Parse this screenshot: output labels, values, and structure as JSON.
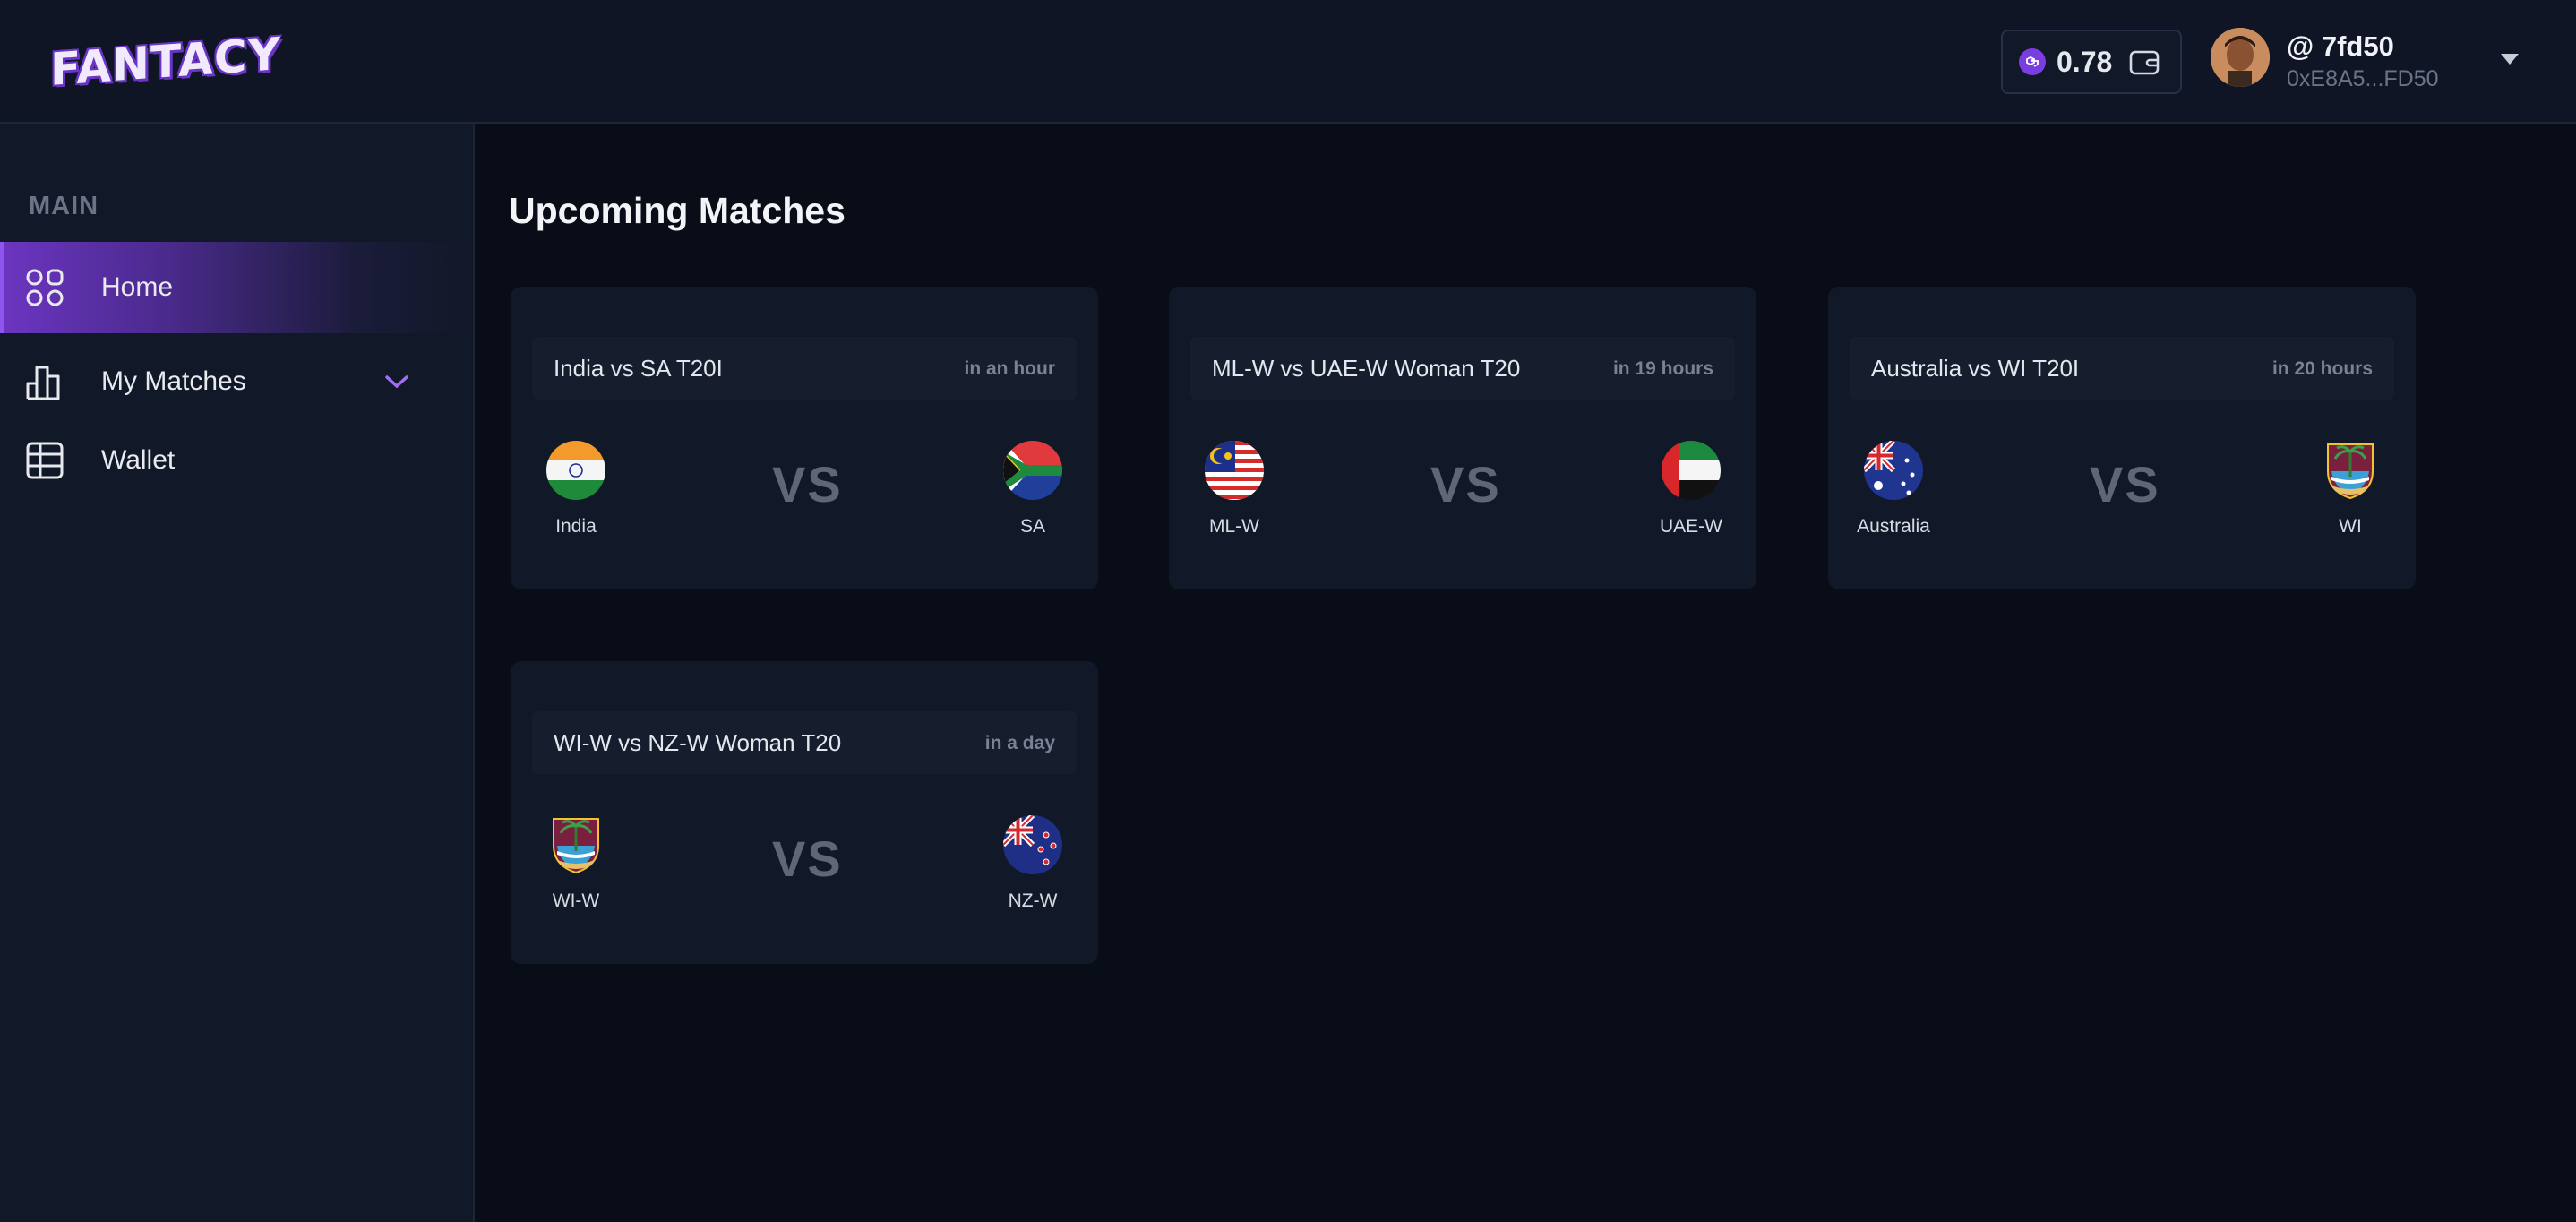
{
  "header": {
    "logo_text": "FANTACY",
    "balance": "0.78",
    "username": "@ 7fd50",
    "address": "0xE8A5...FD50"
  },
  "sidebar": {
    "section": "MAIN",
    "items": [
      {
        "label": "Home",
        "icon": "grid-icon",
        "active": true
      },
      {
        "label": "My Matches",
        "icon": "bar-chart-icon",
        "expandable": true
      },
      {
        "label": "Wallet",
        "icon": "table-icon"
      }
    ]
  },
  "main": {
    "title": "Upcoming Matches",
    "vs_label": "VS",
    "matches": [
      {
        "name": "India vs SA T20I",
        "time": "in an hour",
        "team1": "India",
        "team2": "SA"
      },
      {
        "name": "ML-W vs UAE-W Woman T20",
        "time": "in 19 hours",
        "team1": "ML-W",
        "team2": "UAE-W"
      },
      {
        "name": "Australia vs WI T20I",
        "time": "in 20 hours",
        "team1": "Australia",
        "team2": "WI"
      },
      {
        "name": "WI-W vs NZ-W Woman T20",
        "time": "in a day",
        "team1": "WI-W",
        "team2": "NZ-W"
      }
    ]
  },
  "colors": {
    "background": "#090d18",
    "panel": "#111827",
    "accent": "#7a3ee0"
  }
}
